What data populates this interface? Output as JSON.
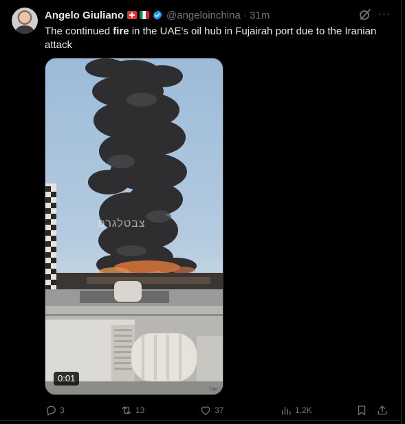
{
  "tweet": {
    "author_name": "Angelo Giuliano",
    "handle_time": "@angeloinchina · 31m",
    "text_before": "The continued ",
    "text_bold": "fire",
    "text_after": " in the UAE's oil hub in Fujairah port due to the Iranian attack"
  },
  "media": {
    "timestamp": "0:01",
    "watermark": "צבטלגרם",
    "corner_text": "Ver"
  },
  "actions": {
    "replies": "3",
    "reposts": "13",
    "likes": "37",
    "views": "1.2K"
  },
  "icons": [
    "swiss-flag-icon",
    "italian-flag-icon",
    "verified-badge-icon",
    "grok-icon",
    "more-icon",
    "reply-icon",
    "repost-icon",
    "like-icon",
    "views-icon",
    "bookmark-icon",
    "share-icon"
  ],
  "colors": {
    "background": "#000000",
    "text": "#e7e9ea",
    "muted": "#71767b",
    "verified": "#1d9bf0"
  }
}
